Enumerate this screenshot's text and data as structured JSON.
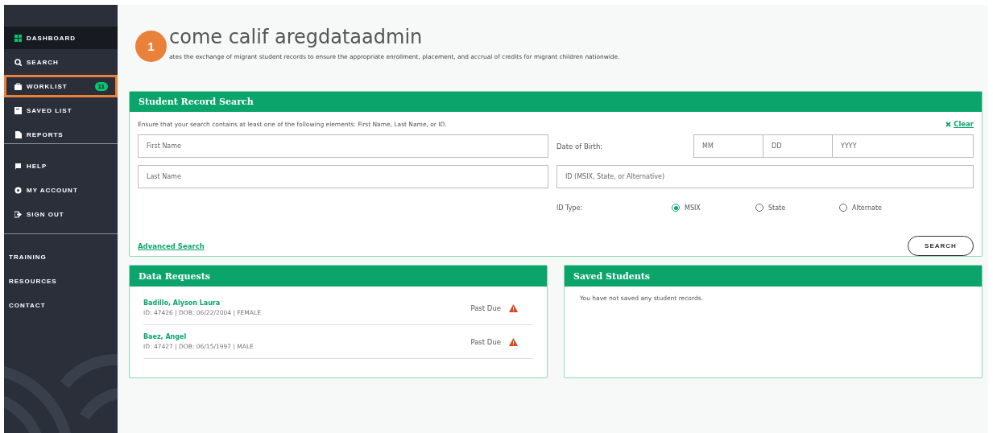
{
  "sidebar": {
    "nav": [
      {
        "label": "DASHBOARD",
        "selected": true,
        "highlighted": false
      },
      {
        "label": "SEARCH",
        "selected": false,
        "highlighted": false
      },
      {
        "label": "WORKLIST",
        "selected": false,
        "highlighted": true,
        "badge": "11"
      },
      {
        "label": "SAVED LIST",
        "selected": false,
        "highlighted": false
      },
      {
        "label": "REPORTS",
        "selected": false,
        "highlighted": false
      }
    ],
    "account": [
      {
        "label": "HELP"
      },
      {
        "label": "MY ACCOUNT"
      },
      {
        "label": "SIGN OUT"
      }
    ],
    "links": [
      {
        "label": "TRAINING"
      },
      {
        "label": "RESOURCES"
      },
      {
        "label": "CONTACT"
      }
    ]
  },
  "annotation": {
    "label": "1"
  },
  "welcome": {
    "title": "come calif aregdataadmin",
    "subtitle": "ates the exchange of migrant student records to ensure the appropriate enrollment, placement, and accrual of credits for migrant children nationwide."
  },
  "search_card": {
    "title": "Student Record Search",
    "hint": "Ensure that your search contains at least one of the following elements: First Name, Last Name, or ID.",
    "clear": "Clear",
    "first_name": {
      "placeholder": "First Name"
    },
    "last_name": {
      "placeholder": "Last Name"
    },
    "dob_label": "Date of Birth:",
    "dob": [
      {
        "placeholder": "MM"
      },
      {
        "placeholder": "DD"
      },
      {
        "placeholder": "YYYY"
      }
    ],
    "id_field": {
      "placeholder": "ID (MSIX, State, or Alternative)"
    },
    "id_type_label": "ID Type:",
    "id_types": [
      {
        "label": "MSIX",
        "selected": true
      },
      {
        "label": "State",
        "selected": false
      },
      {
        "label": "Alternate",
        "selected": false
      }
    ],
    "advanced": "Advanced Search",
    "search_button": "SEARCH"
  },
  "data_requests": {
    "title": "Data Requests",
    "rows": [
      {
        "name": "Badillo, Alyson Laura",
        "details": "ID: 47426 | DOB: 06/22/2004 | FEMALE",
        "status": "Past Due"
      },
      {
        "name": "Baez, Angel",
        "details": "ID: 47427 | DOB: 06/15/1997 | MALE",
        "status": "Past Due"
      }
    ]
  },
  "saved_students": {
    "title": "Saved Students",
    "message": "You have not saved any student records."
  }
}
